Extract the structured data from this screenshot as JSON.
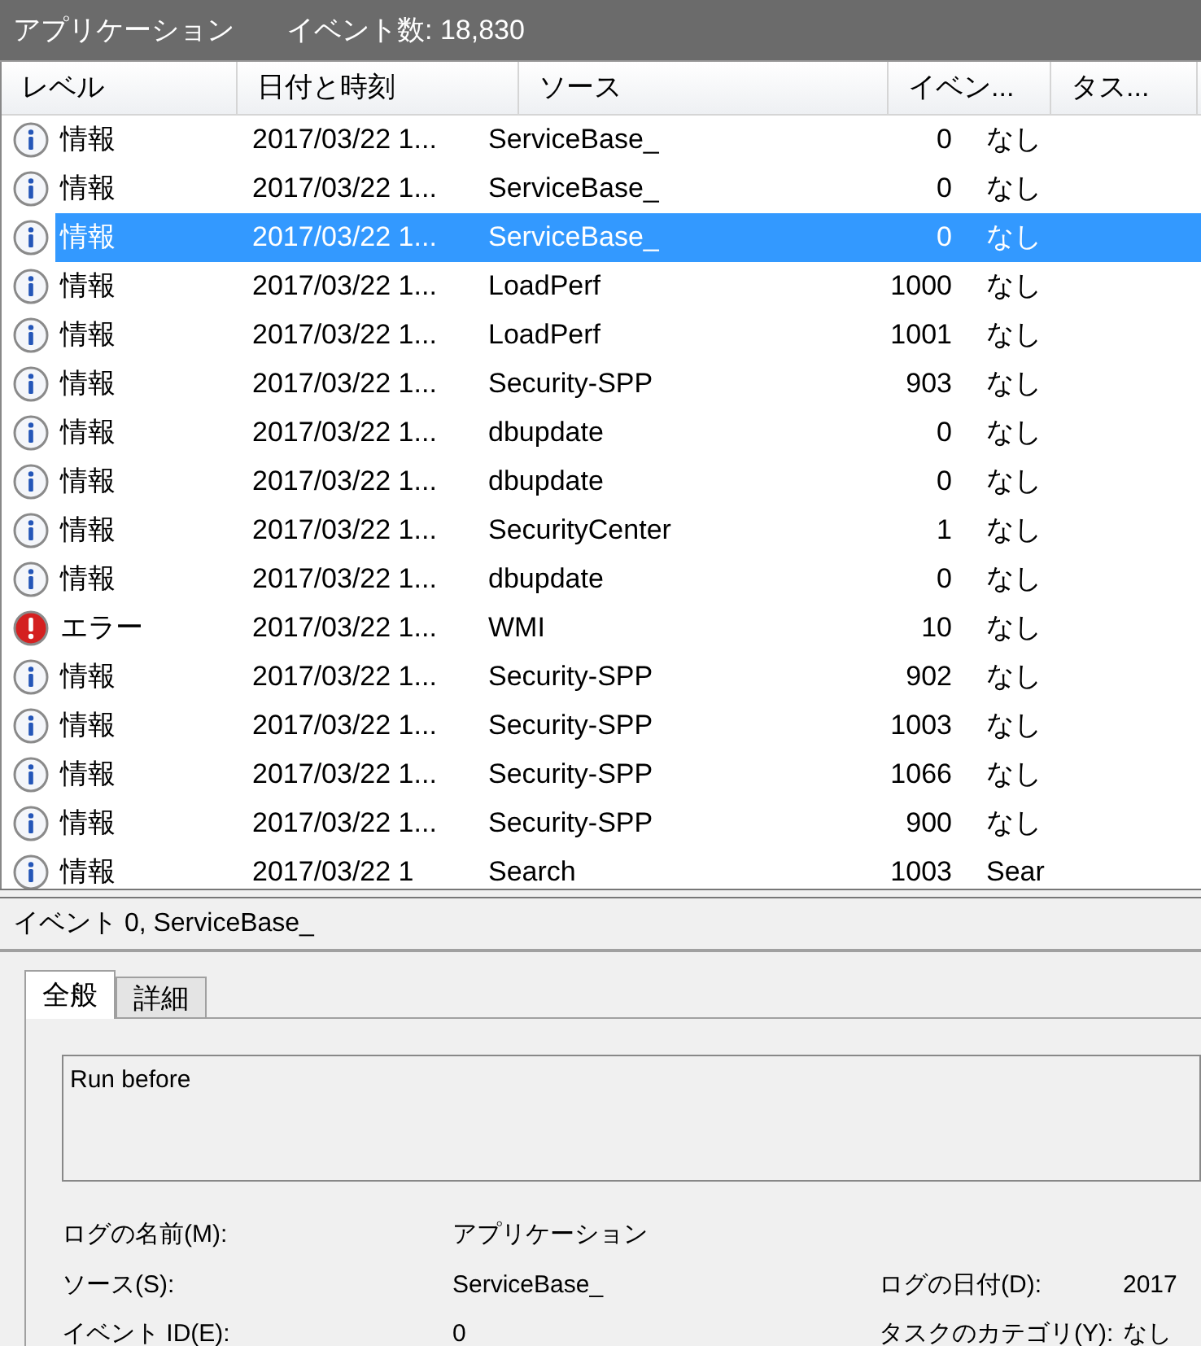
{
  "header": {
    "title": "アプリケーション",
    "count": "イベント数: 18,830"
  },
  "table": {
    "columns": [
      "レベル",
      "日付と時刻",
      "ソース",
      "イベン...",
      "タス..."
    ],
    "rows": [
      {
        "kind": "info",
        "level": "情報",
        "date": "2017/03/22 1...",
        "source": "ServiceBase_",
        "event": "0",
        "task": "なし",
        "selected": false
      },
      {
        "kind": "info",
        "level": "情報",
        "date": "2017/03/22 1...",
        "source": "ServiceBase_",
        "event": "0",
        "task": "なし",
        "selected": false
      },
      {
        "kind": "info",
        "level": "情報",
        "date": "2017/03/22 1...",
        "source": "ServiceBase_",
        "event": "0",
        "task": "なし",
        "selected": true
      },
      {
        "kind": "info",
        "level": "情報",
        "date": "2017/03/22 1...",
        "source": "LoadPerf",
        "event": "1000",
        "task": "なし",
        "selected": false
      },
      {
        "kind": "info",
        "level": "情報",
        "date": "2017/03/22 1...",
        "source": "LoadPerf",
        "event": "1001",
        "task": "なし",
        "selected": false
      },
      {
        "kind": "info",
        "level": "情報",
        "date": "2017/03/22 1...",
        "source": "Security-SPP",
        "event": "903",
        "task": "なし",
        "selected": false
      },
      {
        "kind": "info",
        "level": "情報",
        "date": "2017/03/22 1...",
        "source": "dbupdate",
        "event": "0",
        "task": "なし",
        "selected": false
      },
      {
        "kind": "info",
        "level": "情報",
        "date": "2017/03/22 1...",
        "source": "dbupdate",
        "event": "0",
        "task": "なし",
        "selected": false
      },
      {
        "kind": "info",
        "level": "情報",
        "date": "2017/03/22 1...",
        "source": "SecurityCenter",
        "event": "1",
        "task": "なし",
        "selected": false
      },
      {
        "kind": "info",
        "level": "情報",
        "date": "2017/03/22 1...",
        "source": "dbupdate",
        "event": "0",
        "task": "なし",
        "selected": false
      },
      {
        "kind": "error",
        "level": "エラー",
        "date": "2017/03/22 1...",
        "source": "WMI",
        "event": "10",
        "task": "なし",
        "selected": false
      },
      {
        "kind": "info",
        "level": "情報",
        "date": "2017/03/22 1...",
        "source": "Security-SPP",
        "event": "902",
        "task": "なし",
        "selected": false
      },
      {
        "kind": "info",
        "level": "情報",
        "date": "2017/03/22 1...",
        "source": "Security-SPP",
        "event": "1003",
        "task": "なし",
        "selected": false
      },
      {
        "kind": "info",
        "level": "情報",
        "date": "2017/03/22 1...",
        "source": "Security-SPP",
        "event": "1066",
        "task": "なし",
        "selected": false
      },
      {
        "kind": "info",
        "level": "情報",
        "date": "2017/03/22 1...",
        "source": "Security-SPP",
        "event": "900",
        "task": "なし",
        "selected": false
      },
      {
        "kind": "info",
        "level": "情報",
        "date": "2017/03/22 1",
        "source": "Search",
        "event": "1003",
        "task": "Sear",
        "selected": false
      }
    ]
  },
  "details": {
    "title": "イベント 0, ServiceBase_",
    "tabs": [
      {
        "label": "全般",
        "selected": true
      },
      {
        "label": "詳細",
        "selected": false
      }
    ],
    "message": "Run before",
    "fields": [
      {
        "label": "ログの名前(M):",
        "value": "アプリケーション"
      },
      {
        "label": "ソース(S):",
        "value": "ServiceBase_",
        "label2": "ログの日付(D):",
        "value2": "2017"
      },
      {
        "label": "イベント ID(E):",
        "value": "0",
        "label2": "タスクのカテゴリ(Y):",
        "value2": "なし"
      }
    ]
  }
}
